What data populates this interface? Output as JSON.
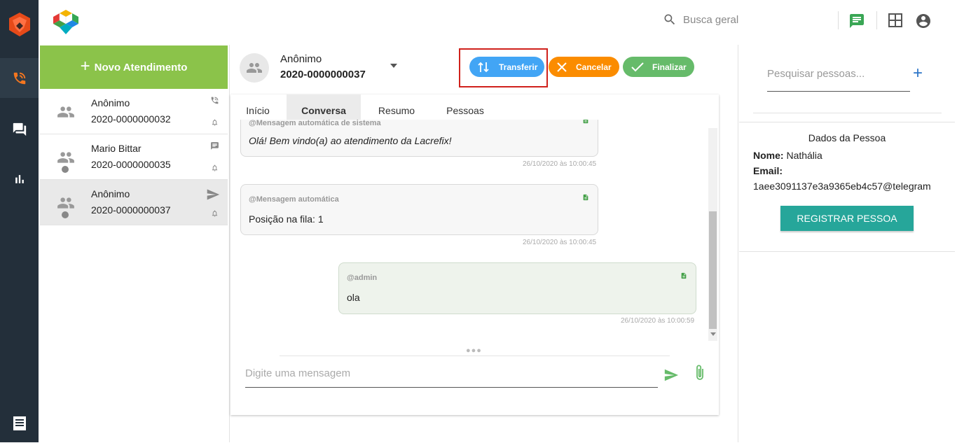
{
  "topbar": {
    "search_placeholder": "Busca geral"
  },
  "left": {
    "new_button": "Novo Atendimento",
    "conversations": [
      {
        "name": "Anônimo",
        "code": "2020-0000000032",
        "channel": "phone-icon",
        "selected": false
      },
      {
        "name": "Mario Bittar",
        "code": "2020-0000000035",
        "channel": "chat-icon",
        "selected": false
      },
      {
        "name": "Anônimo",
        "code": "2020-0000000037",
        "channel": "telegram-icon",
        "selected": true
      }
    ]
  },
  "chat": {
    "contact_name": "Anônimo",
    "contact_code": "2020-0000000037",
    "actions": {
      "transfer": "Transferir",
      "cancel": "Cancelar",
      "finish": "Finalizar"
    },
    "tabs": [
      "Início",
      "Conversa",
      "Resumo",
      "Pessoas"
    ],
    "active_tab": "Conversa",
    "messages": [
      {
        "from": "@Mensagem automática de sistema",
        "text": "Olá! Bem vindo(a) ao atendimento da Lacrefix!",
        "time": "26/10/2020 às 10:00:45"
      },
      {
        "from": "@Mensagem automática",
        "text": "Posição na fila: 1",
        "time": "26/10/2020 às 10:00:45"
      },
      {
        "from": "@admin",
        "text": "ola",
        "time": "26/10/2020 às 10:00:59"
      }
    ],
    "input_placeholder": "Digite uma mensagem"
  },
  "person": {
    "search_placeholder": "Pesquisar pessoas...",
    "title": "Dados da Pessoa",
    "name_label": "Nome:",
    "name_value": "Nathália",
    "email_label": "Email:",
    "email_value": "1aee3091137e3a9365eb4c57@telegram",
    "register_button": "REGISTRAR PESSOA"
  },
  "colors": {
    "nav_bg": "#232f3a",
    "accent_orange": "#f4761f",
    "green_new": "#8bc34a",
    "transfer_blue": "#42a5f5",
    "cancel_orange": "#fb8c00",
    "finish_green": "#66bb6a",
    "teal": "#26a69a",
    "highlight_red": "#d0211c"
  }
}
